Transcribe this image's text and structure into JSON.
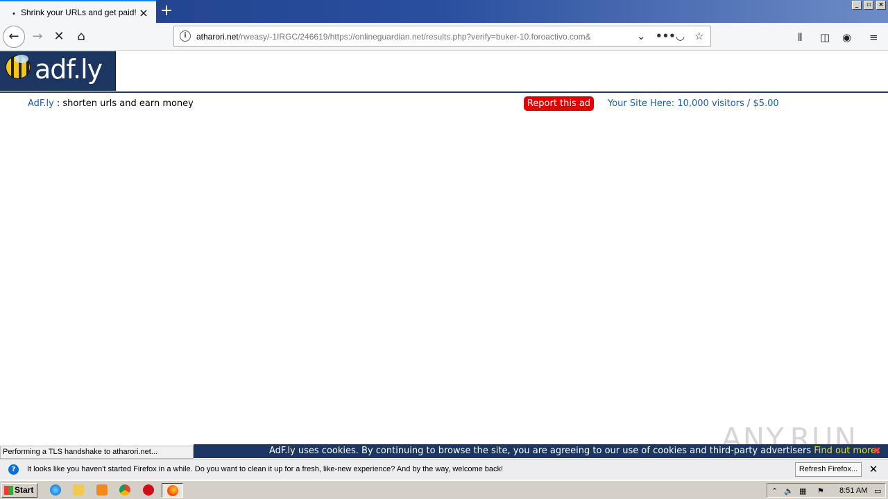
{
  "browser": {
    "tab_title": "Shrink your URLs and get paid!",
    "tab_close_icon": "×",
    "new_tab_icon": "+",
    "url_host": "atharori.net",
    "url_rest": "/rweasy/-1IRGC/246619/https://onlineguardian.net/results.php?verify=buker-10.foroactivo.com&",
    "status": "Performing a TLS handshake to atharori.net..."
  },
  "page": {
    "logo_text": "adf.ly",
    "brand_link": "AdF.ly",
    "tagline": " : shorten urls and earn money",
    "report_label": "Report this ad",
    "your_site": "Your Site Here: 10,000 visitors / $5.00"
  },
  "cookie_banner": {
    "message": "AdF.ly uses cookies. By continuing to browse the site, you are agreeing to our use of cookies and third-party advertisers ",
    "link": "Find out more.",
    "close": "✖"
  },
  "watermark": "ANY.RUN",
  "notification": {
    "message": "It looks like you haven't started Firefox in a while. Do you want to clean it up for a fresh, like-new experience? And by the way, welcome back!",
    "refresh_label": "Refresh Firefox...",
    "close": "✕"
  },
  "taskbar": {
    "start_label": "Start",
    "clock": "8:51 AM"
  }
}
